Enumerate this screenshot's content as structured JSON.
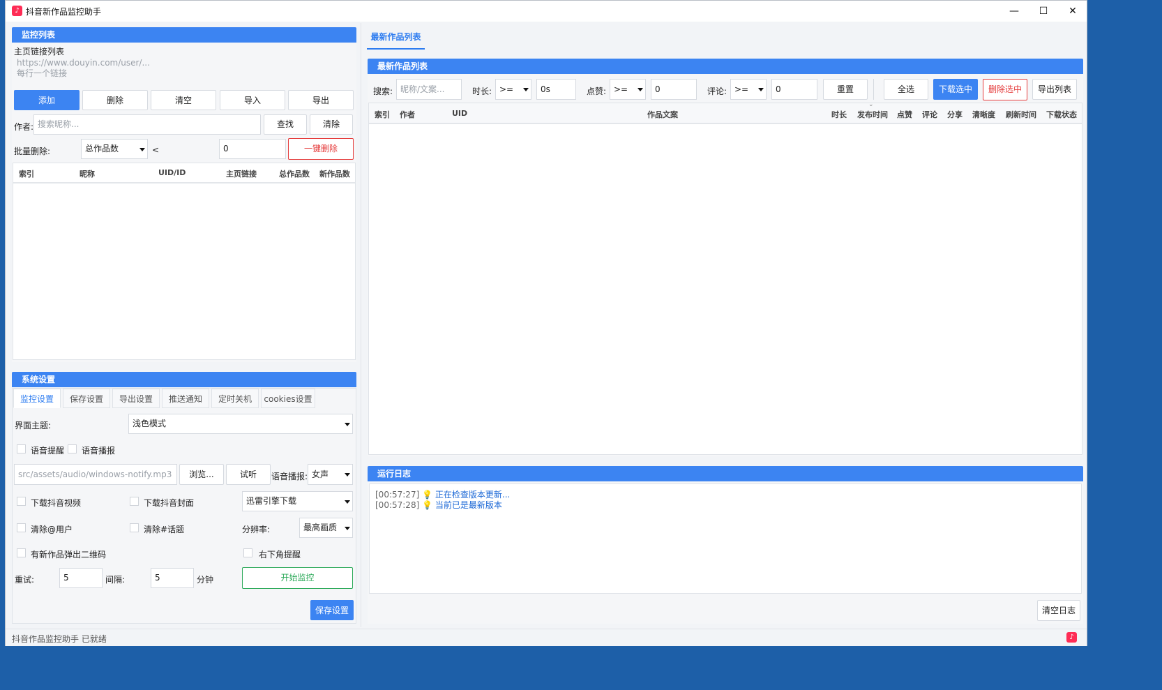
{
  "window": {
    "title": "抖音新作品监控助手",
    "minimize": "—",
    "maximize": "☐",
    "close": "✕"
  },
  "monitor": {
    "header": "监控列表",
    "links_label": "主页链接列表",
    "links_placeholder_line1": "https://www.douyin.com/user/...",
    "links_placeholder_line2": "每行一个链接",
    "buttons": [
      "添加",
      "删除",
      "清空",
      "导入",
      "导出"
    ],
    "author_label": "作者:",
    "author_placeholder": "搜索昵称...",
    "find_button": "查找",
    "clear_button": "清除",
    "batch_label": "批量删除:",
    "batch_field": "总作品数",
    "batch_op": "<",
    "batch_value": "0",
    "batch_delete_button": "一键删除",
    "columns": [
      "索引",
      "昵称",
      "UID/ID",
      "主页链接",
      "总作品数",
      "新作品数"
    ]
  },
  "settings": {
    "header": "系统设置",
    "tabs": [
      "监控设置",
      "保存设置",
      "导出设置",
      "推送通知",
      "定时关机",
      "cookies设置"
    ],
    "theme_label": "界面主题:",
    "theme_value": "浅色模式",
    "voice_alert": "语音提醒",
    "voice_broadcast": "语音播报",
    "audio_path": "src/assets/audio/windows-notify.mp3",
    "browse_button": "浏览...",
    "listen_button": "试听",
    "voice_type_label": "语音播报:",
    "voice_type_value": "女声",
    "download_video": "下载抖音视频",
    "download_cover": "下载抖音封面",
    "download_engine": "迅雷引擎下载",
    "clear_at_user": "清除@用户",
    "clear_topic": "清除#话题",
    "resolution_label": "分辨率:",
    "resolution_value": "最高画质",
    "qr_popup": "有新作品弹出二维码",
    "corner_alert": "右下角提醒",
    "retry_label": "重试:",
    "retry_value": "5",
    "interval_label": "间隔:",
    "interval_value": "5",
    "minutes_label": "分钟",
    "start_button": "开始监控",
    "save_button": "保存设置"
  },
  "works": {
    "tab": "最新作品列表",
    "header": "最新作品列表",
    "search_label": "搜索:",
    "search_placeholder": "昵称/文案...",
    "duration_label": "时长:",
    "duration_op": ">=",
    "duration_value": "0s",
    "likes_label": "点赞:",
    "likes_op": ">=",
    "likes_value": "0",
    "comments_label": "评论:",
    "comments_op": ">=",
    "comments_value": "0",
    "reset_button": "重置",
    "select_all_button": "全选",
    "download_selected_button": "下载选中",
    "delete_selected_button": "删除选中",
    "export_list_button": "导出列表",
    "columns": [
      "索引",
      "作者",
      "UID",
      "作品文案",
      "时长",
      "发布时间",
      "点赞",
      "评论",
      "分享",
      "清晰度",
      "刷新时间",
      "下载状态"
    ]
  },
  "log": {
    "header": "运行日志",
    "entries": [
      {
        "time": "[00:57:27]",
        "message": "正在检查版本更新..."
      },
      {
        "time": "[00:57:28]",
        "message": "当前已是最新版本"
      }
    ],
    "clear_button": "清空日志"
  },
  "status": {
    "text": "抖音作品监控助手 已就绪"
  },
  "colors": {
    "accent": "#3c84f2",
    "danger": "#e53b3b",
    "success": "#2daa5a",
    "brand": "#fe2c55"
  }
}
